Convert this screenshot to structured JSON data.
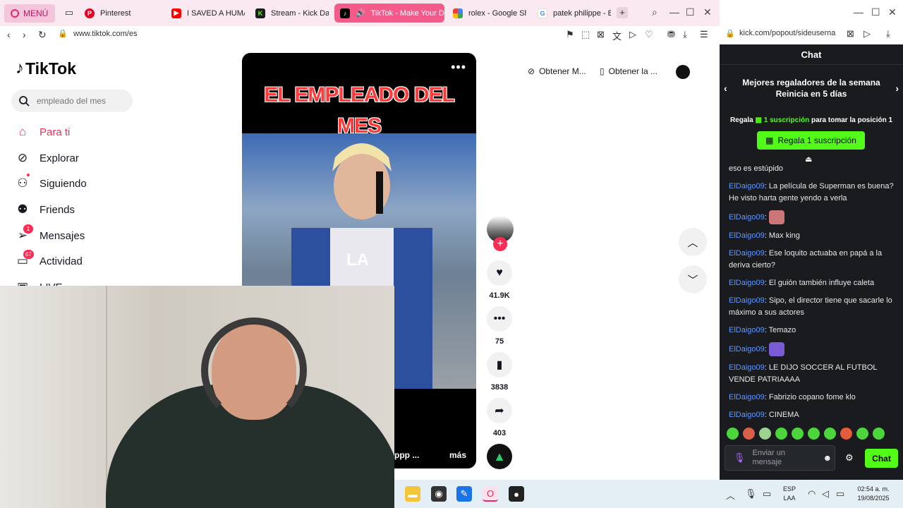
{
  "browser": {
    "menu_label": "MENÚ",
    "tabs": [
      {
        "label": "Pinterest",
        "icon": "pinterest-icon",
        "color": "#e60023"
      },
      {
        "label": "I SAVED A HUMA",
        "icon": "youtube-icon",
        "color": "#ff0000"
      },
      {
        "label": "Stream - Kick Da",
        "icon": "kick-icon",
        "color": "#1c1c1c"
      },
      {
        "label": "TikTok - Make Your D",
        "icon": "tiktok-icon",
        "color": "#000000",
        "active": true
      },
      {
        "label": "rolex - Google Sh",
        "icon": "google-shopping-icon",
        "color": "#4285f4"
      },
      {
        "label": "patek philippe - B",
        "icon": "google-icon",
        "color": "#4285f4"
      }
    ],
    "url": "www.tiktok.com/es"
  },
  "tiktok": {
    "logo": "TikTok",
    "search_placeholder": "empleado del mes",
    "nav": [
      {
        "label": "Para ti",
        "icon": "home-icon",
        "active": true
      },
      {
        "label": "Explorar",
        "icon": "compass-icon"
      },
      {
        "label": "Siguiendo",
        "icon": "following-icon"
      },
      {
        "label": "Friends",
        "icon": "friends-icon"
      },
      {
        "label": "Mensajes",
        "icon": "messages-icon",
        "badge": "1"
      },
      {
        "label": "Actividad",
        "icon": "activity-icon",
        "badge": "67"
      },
      {
        "label": "LIVE",
        "icon": "live-icon"
      }
    ],
    "top_buttons": [
      {
        "label": "Obtener M...",
        "icon": "coins-icon"
      },
      {
        "label": "Obtener la ...",
        "icon": "phone-icon"
      }
    ],
    "video": {
      "title": "EL EMPLEADO DEL MES",
      "caption": "LA",
      "desc": "ppp  ...",
      "more": "más"
    },
    "actions": {
      "likes": "41.9K",
      "comments": "75",
      "saves": "3838",
      "shares": "403"
    }
  },
  "kick": {
    "url": "kick.com/popout/sideuserna",
    "header": "Chat",
    "leaders_line1": "Mejores regaladores de la semana",
    "leaders_line2": "Reinicia en 5 días",
    "gift_prefix": "Regala",
    "gift_highlight": "1 suscripción",
    "gift_suffix": "para tomar la posición 1",
    "gift_button": "Regala 1 suscripción",
    "messages": [
      {
        "user": "",
        "text": "eso es estúpido"
      },
      {
        "user": "ElDaigo09",
        "text": ": La película de Superman es buena? He visto harta gente yendo a verla"
      },
      {
        "user": "ElDaigo09",
        "text": ":",
        "emote": true
      },
      {
        "user": "ElDaigo09",
        "text": ": Max king"
      },
      {
        "user": "ElDaigo09",
        "text": ": Ese loquito actuaba en papá a la deriva cierto?"
      },
      {
        "user": "ElDaigo09",
        "text": ": El guión también influye caleta"
      },
      {
        "user": "ElDaigo09",
        "text": ": Sipo, el director tiene que sacarle lo máximo a sus actores"
      },
      {
        "user": "ElDaigo09",
        "text": ": Temazo"
      },
      {
        "user": "ElDaigo09",
        "text": ":",
        "emote": true
      },
      {
        "user": "ElDaigo09",
        "text": ": LE DIJO SOCCER AL FUTBOL VENDE PATRIAAAA"
      },
      {
        "user": "ElDaigo09",
        "text": ": Fabrizio copano fome klo"
      },
      {
        "user": "ElDaigo09",
        "text": ": CINEMA"
      }
    ],
    "input_placeholder": "Enviar un mensaje",
    "send_label": "Chat"
  },
  "taskbar": {
    "lang1": "ESP",
    "lang2": "LAA",
    "time": "02:54 a. m.",
    "date": "19/08/2025"
  },
  "colors": {
    "tiktok_accent": "#fe2c55",
    "kick_green": "#53fc18",
    "kick_user": "#5f96ff"
  }
}
